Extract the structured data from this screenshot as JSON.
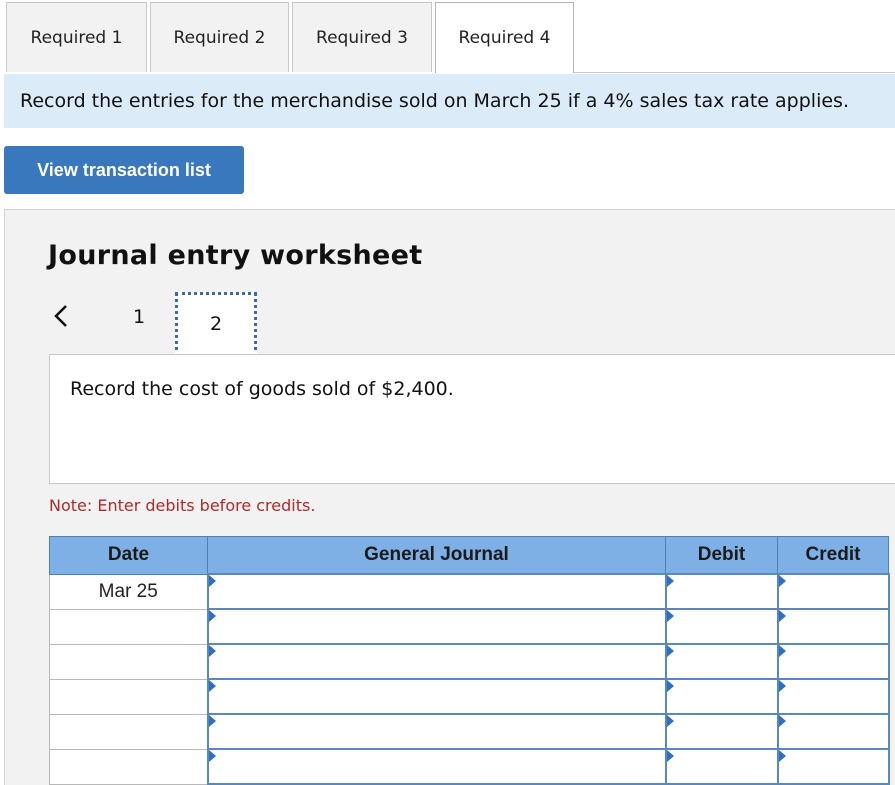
{
  "tabs": [
    {
      "label": "Required 1",
      "active": false
    },
    {
      "label": "Required 2",
      "active": false
    },
    {
      "label": "Required 3",
      "active": false
    },
    {
      "label": "Required 4",
      "active": true
    }
  ],
  "instruction": "Record the entries for the merchandise sold on March 25 if a 4% sales tax rate applies.",
  "view_transactions_label": "View transaction list",
  "worksheet": {
    "title": "Journal entry worksheet",
    "pager": {
      "prev_icon": "chevron-left-icon",
      "pages": [
        "1",
        "2"
      ],
      "current": "2"
    },
    "prompt": "Record the cost of goods sold of $2,400.",
    "note": "Note: Enter debits before credits."
  },
  "journal": {
    "headers": {
      "date": "Date",
      "account": "General Journal",
      "debit": "Debit",
      "credit": "Credit"
    },
    "rows": [
      {
        "date": "Mar 25",
        "account": "",
        "debit": "",
        "credit": ""
      },
      {
        "date": "",
        "account": "",
        "debit": "",
        "credit": ""
      },
      {
        "date": "",
        "account": "",
        "debit": "",
        "credit": ""
      },
      {
        "date": "",
        "account": "",
        "debit": "",
        "credit": ""
      },
      {
        "date": "",
        "account": "",
        "debit": "",
        "credit": ""
      },
      {
        "date": "",
        "account": "",
        "debit": "",
        "credit": ""
      }
    ]
  },
  "colors": {
    "tab_bg": "#f2f2f2",
    "banner_bg": "#dcebf8",
    "button_bg": "#3a78be",
    "header_bg": "#7eb0e5",
    "note_color": "#b02a2a",
    "panel_bg": "#f2f2f2"
  }
}
